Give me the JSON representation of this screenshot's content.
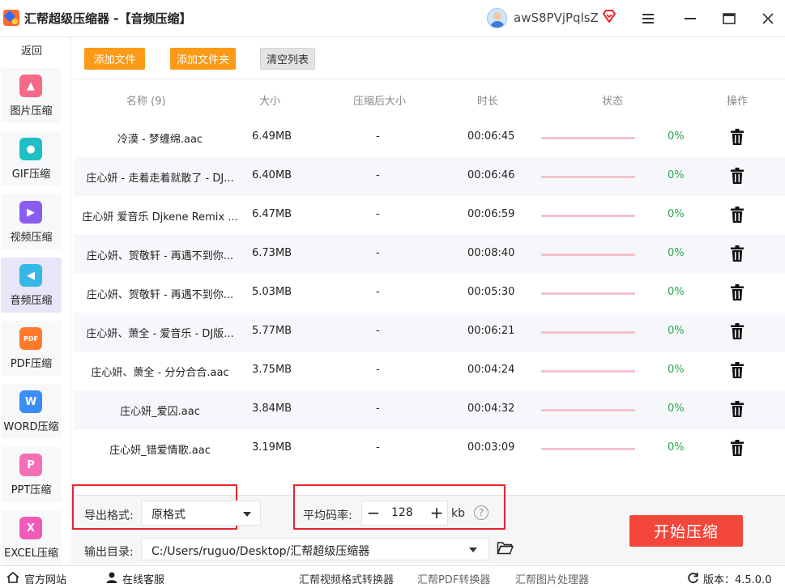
{
  "window": {
    "title": "汇帮超级压缩器 -【音频压缩】",
    "username": "awS8PVjPqlsZ"
  },
  "sidebar": {
    "back": "返回",
    "items": [
      {
        "label": "图片压缩",
        "icon": "image-icon",
        "color": "#f56a86"
      },
      {
        "label": "GIF压缩",
        "icon": "gif-icon",
        "color": "#1fbfc6"
      },
      {
        "label": "视频压缩",
        "icon": "video-icon",
        "color": "#8a5cf0"
      },
      {
        "label": "音频压缩",
        "icon": "audio-icon",
        "color": "#35b8e6"
      },
      {
        "label": "PDF压缩",
        "icon": "pdf-icon",
        "color": "#ff7a2d"
      },
      {
        "label": "WORD压缩",
        "icon": "word-icon",
        "color": "#3a8df5"
      },
      {
        "label": "PPT压缩",
        "icon": "ppt-icon",
        "color": "#f36fb6"
      },
      {
        "label": "EXCEL压缩",
        "icon": "excel-icon",
        "color": "#f05ab8"
      }
    ],
    "active_index": 3
  },
  "toolbar": {
    "add_file": "添加文件",
    "add_folder": "添加文件夹",
    "clear_list": "清空列表"
  },
  "table": {
    "headers": {
      "name": "名称 (9)",
      "size": "大小",
      "compressed_size": "压缩后大小",
      "duration": "时长",
      "status": "状态",
      "action": "操作"
    },
    "rows": [
      {
        "name": "冷漠 - 梦缠绵.aac",
        "size": "6.49MB",
        "compressed": "-",
        "duration": "00:06:45",
        "progress": 0,
        "percent": "0%"
      },
      {
        "name": "庄心妍 - 走着走着就散了 - DJ...",
        "size": "6.40MB",
        "compressed": "-",
        "duration": "00:06:46",
        "progress": 0,
        "percent": "0%"
      },
      {
        "name": "庄心妍 爱音乐 Djkene Remix ...",
        "size": "6.47MB",
        "compressed": "-",
        "duration": "00:06:59",
        "progress": 0,
        "percent": "0%"
      },
      {
        "name": "庄心妍、贺敬轩 - 再遇不到你...",
        "size": "6.73MB",
        "compressed": "-",
        "duration": "00:08:40",
        "progress": 0,
        "percent": "0%"
      },
      {
        "name": "庄心妍、贺敬轩 - 再遇不到你...",
        "size": "5.03MB",
        "compressed": "-",
        "duration": "00:05:30",
        "progress": 0,
        "percent": "0%"
      },
      {
        "name": "庄心妍、萧全 - 爱音乐 - DJ版...",
        "size": "5.77MB",
        "compressed": "-",
        "duration": "00:06:21",
        "progress": 0,
        "percent": "0%"
      },
      {
        "name": "庄心妍、萧全 - 分分合合.aac",
        "size": "3.75MB",
        "compressed": "-",
        "duration": "00:04:24",
        "progress": 0,
        "percent": "0%"
      },
      {
        "name": "庄心妍_爱囚.aac",
        "size": "3.84MB",
        "compressed": "-",
        "duration": "00:04:32",
        "progress": 0,
        "percent": "0%"
      },
      {
        "name": "庄心妍_错爱情歌.aac",
        "size": "3.19MB",
        "compressed": "-",
        "duration": "00:03:09",
        "progress": 0,
        "percent": "0%"
      }
    ]
  },
  "settings": {
    "format_label": "导出格式:",
    "format_value": "原格式",
    "bitrate_label": "平均码率:",
    "bitrate_value": "128",
    "bitrate_unit": "kb",
    "output_label": "输出目录:",
    "output_path": "C:/Users/ruguo/Desktop/汇帮超级压缩器",
    "start_button": "开始压缩"
  },
  "footer": {
    "website": "官方网站",
    "support": "在线客服",
    "link1": "汇帮视频格式转换器",
    "link2": "汇帮PDF转换器",
    "link3": "汇帮图片处理器",
    "version": "版本：4.5.0.0"
  },
  "colors": {
    "accent_orange": "#fb9a17",
    "start_red": "#f4473b",
    "highlight_red": "#e8242b",
    "success_green": "#27a84a",
    "progress_pink": "#f3c3ce"
  }
}
